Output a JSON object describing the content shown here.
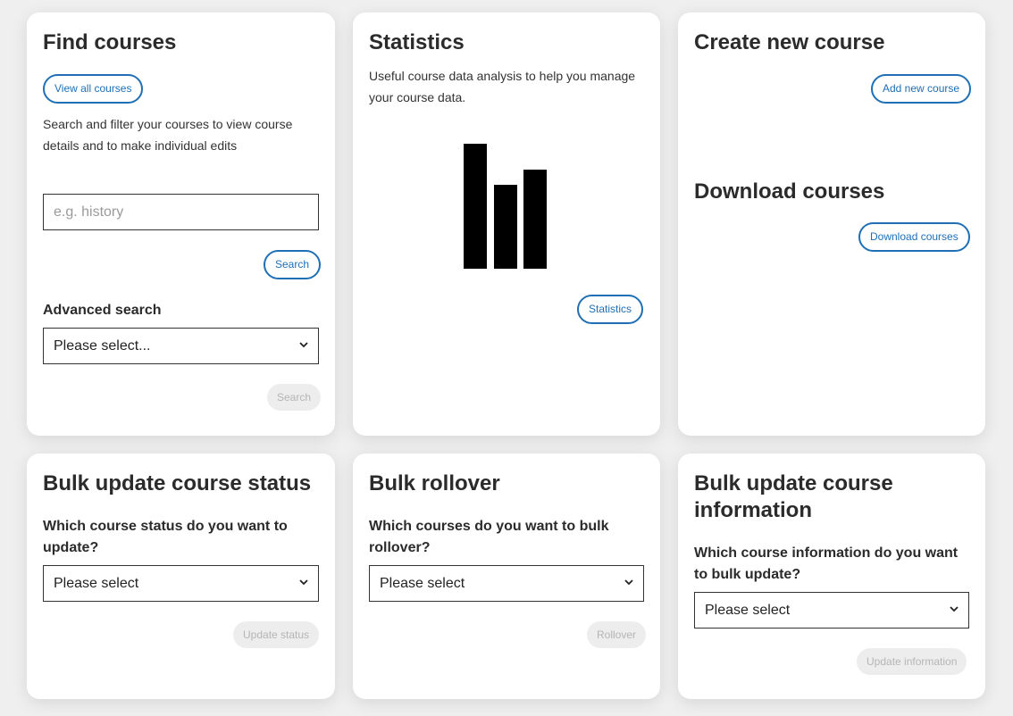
{
  "find_courses": {
    "title": "Find courses",
    "view_all_label": "View all courses",
    "description": "Search and filter your courses to view course details and to make individual edits",
    "search_placeholder": "e.g. history",
    "search_label": "Search",
    "advanced_label": "Advanced search",
    "advanced_select_value": "Please select...",
    "advanced_search_label": "Search"
  },
  "statistics": {
    "title": "Statistics",
    "description": "Useful course data analysis to help you manage your course data.",
    "button_label": "Statistics",
    "icon": "bar-chart-icon",
    "icon_bar_levels": [
      1.0,
      0.67,
      0.79
    ]
  },
  "create_course": {
    "title": "Create new course",
    "button_label": "Add new course"
  },
  "download_courses": {
    "title": "Download courses",
    "button_label": "Download courses"
  },
  "bulk_status": {
    "title": "Bulk update course status",
    "question": "Which course status do you want to update?",
    "select_value": "Please select",
    "button_label": "Update status"
  },
  "bulk_rollover": {
    "title": "Bulk rollover",
    "question": "Which courses do you want to bulk rollover?",
    "select_value": "Please select",
    "button_label": "Rollover"
  },
  "bulk_info": {
    "title": "Bulk update course information",
    "question": "Which course information do you want to bulk update?",
    "select_value": "Please select",
    "button_label": "Update information"
  },
  "colors": {
    "accent": "#1f6fb5",
    "disabled_bg": "#ededed",
    "disabled_text": "#b5b5b5",
    "page_bg": "#efefef"
  }
}
